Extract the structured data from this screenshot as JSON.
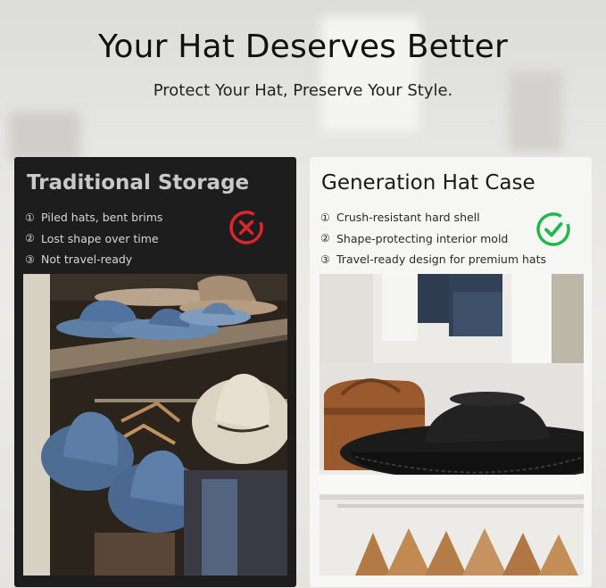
{
  "header": {
    "title": "Your Hat Deserves Better",
    "subtitle": "Protect Your Hat, Preserve Your Style."
  },
  "left_panel": {
    "title": "Traditional Storage",
    "features": [
      {
        "num": "①",
        "text": "Piled hats, bent brims"
      },
      {
        "num": "②",
        "text": "Lost shape over time"
      },
      {
        "num": "③",
        "text": "Not travel-ready"
      }
    ],
    "status_icon": "x-circle-icon",
    "status_color": "#e0242b"
  },
  "right_panel": {
    "title": "Generation Hat Case",
    "features": [
      {
        "num": "①",
        "text": "Crush-resistant hard shell"
      },
      {
        "num": "②",
        "text": "Shape-protecting interior mold"
      },
      {
        "num": "③",
        "text": "Travel-ready design for premium hats"
      }
    ],
    "status_icon": "check-circle-icon",
    "status_color": "#1fb94a"
  }
}
